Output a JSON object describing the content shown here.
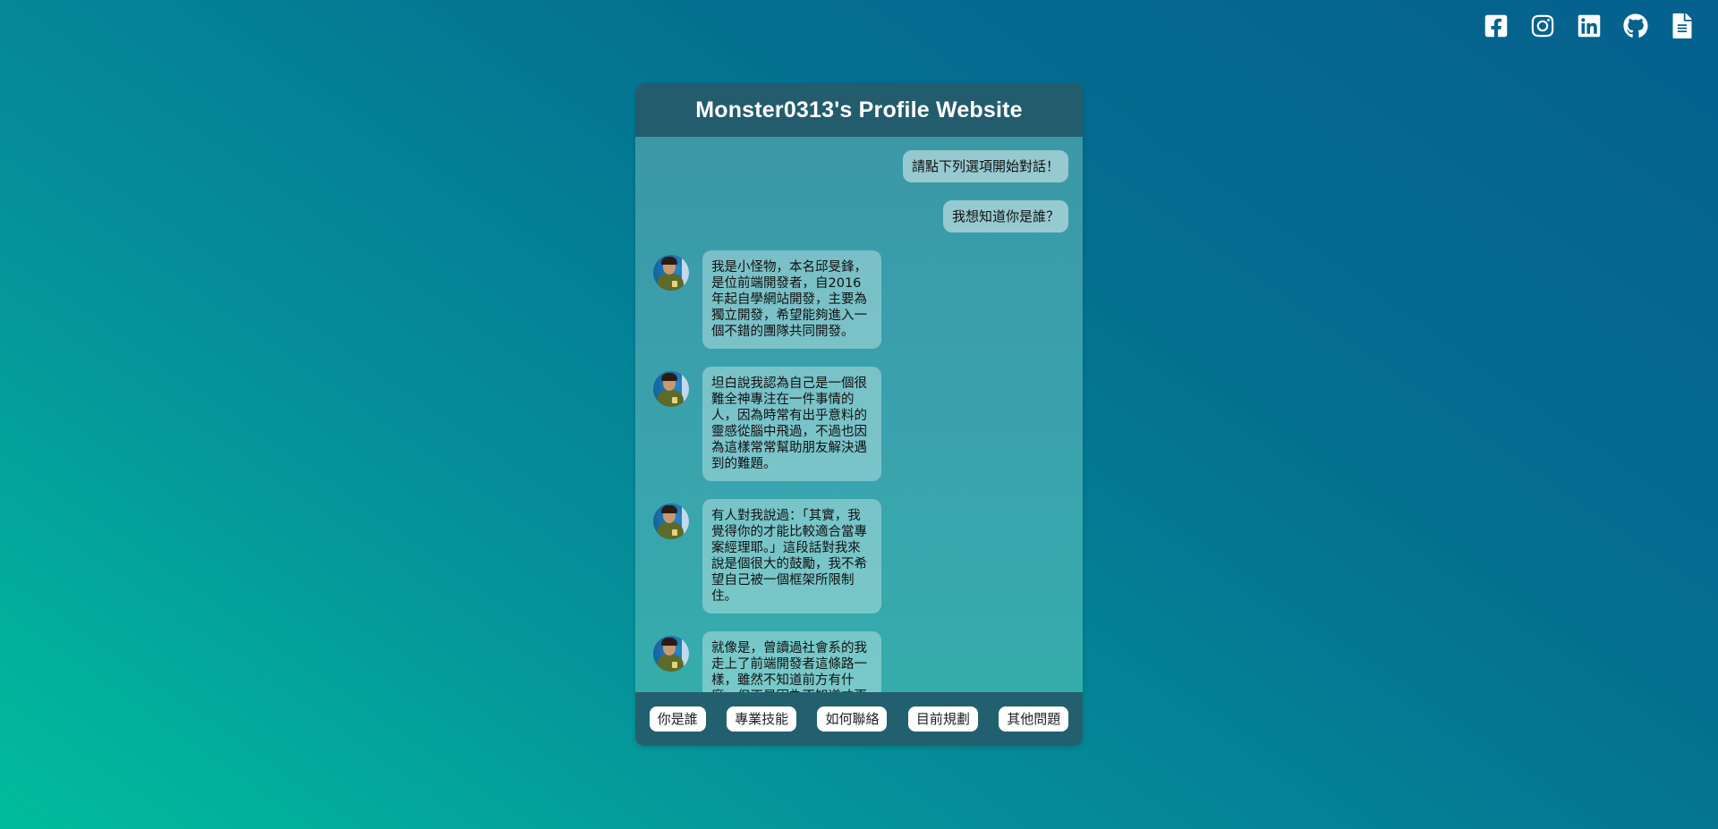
{
  "social": [
    {
      "icon": "facebook-icon",
      "name": "facebook-link"
    },
    {
      "icon": "instagram-icon",
      "name": "instagram-link"
    },
    {
      "icon": "linkedin-icon",
      "name": "linkedin-link"
    },
    {
      "icon": "github-icon",
      "name": "github-link"
    },
    {
      "icon": "resume-document-icon",
      "name": "resume-link"
    }
  ],
  "chat": {
    "title": "Monster0313's Profile Website",
    "user_messages": [
      "請點下列選項開始對話！",
      "我想知道你是誰？"
    ],
    "bot_messages": [
      "我是小怪物，本名邱旻鋒，是位前端開發者，自2016年起自學網站開發，主要為獨立開發，希望能夠進入一個不錯的團隊共同開發。",
      "坦白說我認為自己是一個很難全神專注在一件事情的人，因為時常有出乎意料的靈感從腦中飛過，不過也因為這樣常常幫助朋友解決遇到的難題。",
      "有人對我說過：「其實，我覺得你的才能比較適合當專案經理耶。」這段話對我來說是個很大的鼓勵，我不希望自己被一個框架所限制住。",
      "就像是，曾讀過社會系的我走上了前端開發者這條路一樣，雖然不知道前方有什麼，但正是因為不知道才更精彩。"
    ],
    "options": [
      "你是誰",
      "專業技能",
      "如何聯絡",
      "目前規劃",
      "其他問題"
    ]
  },
  "colors": {
    "header": "#235c6c",
    "background_top": "#05608e",
    "background_bottom": "#01bd9c"
  }
}
